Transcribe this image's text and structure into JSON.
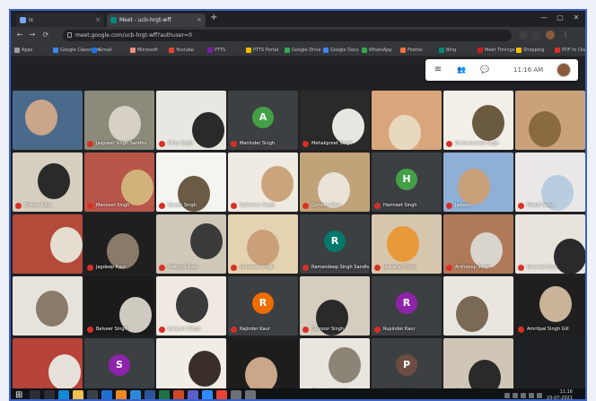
{
  "browser": {
    "tabs": [
      {
        "label": "Is",
        "active": false
      },
      {
        "label": "Meet - ucb-hrgt-wff",
        "active": true
      }
    ],
    "new_tab_symbol": "+",
    "address": "meet.google.com/ucb-hrgt-wff?authuser=0",
    "window_controls": [
      "—",
      "▢",
      "✕"
    ],
    "nav_icons": [
      "back-icon",
      "forward-icon",
      "reload-icon"
    ],
    "bookmarks": [
      "Apps",
      "Google Classroom",
      "Gmail",
      "Microsoft",
      "Youtube",
      "PTTS",
      "PTTS Portal",
      "Google Drive",
      "Google Docs",
      "WhatsApp",
      "Firefox",
      "Bing",
      "Meet Timings",
      "Shopping",
      "PDF to Doc"
    ]
  },
  "meet": {
    "toolbar_icons": [
      "menu-icon",
      "people-icon",
      "chat-icon"
    ],
    "time": "11:16 AM",
    "accent": "#1a73e8"
  },
  "participants": [
    {
      "name": "",
      "kind": "video",
      "colors": [
        "#4a6a8c",
        "#c9a58a"
      ]
    },
    {
      "name": "Jaspreet Singh Sandhu",
      "kind": "video",
      "colors": [
        "#8c8a7a",
        "#d6d1c4"
      ]
    },
    {
      "name": "Pintu Singh",
      "kind": "video",
      "colors": [
        "#e9e7e2",
        "#2a2a2a"
      ]
    },
    {
      "name": "Maninder Singh",
      "kind": "avatar",
      "initial": "A",
      "color": "#43a047"
    },
    {
      "name": "Mehakpreet Singh",
      "kind": "video",
      "colors": [
        "#2a2a2a",
        "#e8e6e1"
      ]
    },
    {
      "name": "",
      "kind": "video",
      "colors": [
        "#d9a57a",
        "#e8d8c0"
      ]
    },
    {
      "name": "Harmanpreet Singh",
      "kind": "video",
      "colors": [
        "#f2efe8",
        "#6a5a40"
      ]
    },
    {
      "name": "",
      "kind": "video",
      "colors": [
        "#c9a27a",
        "#8a6a40"
      ]
    },
    {
      "name": "Simran Kaur",
      "kind": "video",
      "colors": [
        "#d6cfc0",
        "#2a2a2a"
      ]
    },
    {
      "name": "Manveer Singh",
      "kind": "video",
      "colors": [
        "#b8564a",
        "#d1b27a"
      ]
    },
    {
      "name": "Navjot Singh",
      "kind": "video",
      "colors": [
        "#f4f4f1",
        "#6b5b45"
      ]
    },
    {
      "name": "Sukhman Singh",
      "kind": "video",
      "colors": [
        "#efeae2",
        "#caa47c"
      ]
    },
    {
      "name": "Gurleen Kaur",
      "kind": "video",
      "colors": [
        "#c1a37a",
        "#e9e3d8"
      ]
    },
    {
      "name": "Harmeet Singh",
      "kind": "avatar",
      "initial": "H",
      "color": "#43a047"
    },
    {
      "name": "Jasleen",
      "kind": "video",
      "colors": [
        "#8fb0d6",
        "#c8a07a"
      ]
    },
    {
      "name": "Manjit Singh",
      "kind": "video",
      "colors": [
        "#e9e8e6",
        "#b9cde0"
      ]
    },
    {
      "name": "",
      "kind": "video",
      "colors": [
        "#b34a3a",
        "#e4ddd0"
      ]
    },
    {
      "name": "Jagdeep Kaur",
      "kind": "video",
      "colors": [
        "#1f1f1f",
        "#8a7a68"
      ]
    },
    {
      "name": "Prabhjot Kaur",
      "kind": "video",
      "colors": [
        "#cfc7b8",
        "#3a3a3a"
      ]
    },
    {
      "name": "Gurpreet Singh",
      "kind": "video",
      "colors": [
        "#e4d2b0",
        "#caa07a"
      ]
    },
    {
      "name": "Ramandeep Singh Sandhu",
      "kind": "avatar",
      "initial": "R",
      "color": "#00796b"
    },
    {
      "name": "Jaskaran Singh",
      "kind": "video",
      "colors": [
        "#d7c6ae",
        "#e89a3a"
      ]
    },
    {
      "name": "Arshdeep Singh",
      "kind": "video",
      "colors": [
        "#b07a5a",
        "#d9d4cc"
      ]
    },
    {
      "name": "Navneet Kaur",
      "kind": "video",
      "colors": [
        "#e8e4dc",
        "#2a2a2a"
      ]
    },
    {
      "name": "",
      "kind": "video",
      "colors": [
        "#e6e3dd",
        "#8a7a6a"
      ]
    },
    {
      "name": "Balveer Singh",
      "kind": "video",
      "colors": [
        "#1b1b1b",
        "#cfcac0"
      ]
    },
    {
      "name": "Karanvir Singh",
      "kind": "video",
      "colors": [
        "#efe9e1",
        "#3a3a3a"
      ]
    },
    {
      "name": "Rajinder Kaur",
      "kind": "avatar",
      "initial": "R",
      "color": "#ef6c00"
    },
    {
      "name": "Gurnoor Singh",
      "kind": "video",
      "colors": [
        "#d5cdbf",
        "#2a2a2a"
      ]
    },
    {
      "name": "Rupinder Kaur",
      "kind": "avatar",
      "initial": "R",
      "color": "#8e24aa"
    },
    {
      "name": "",
      "kind": "video",
      "colors": [
        "#eae6df",
        "#7a6a55"
      ]
    },
    {
      "name": "Amritpal Singh Gill",
      "kind": "video",
      "colors": [
        "#1f1f1f",
        "#c9b49a"
      ]
    },
    {
      "name": "Tanveer Singh",
      "kind": "video",
      "colors": [
        "#b7433a",
        "#e6e1d9"
      ]
    },
    {
      "name": "Sukhpreet Kaur",
      "kind": "avatar",
      "initial": "S",
      "color": "#8e24aa"
    },
    {
      "name": "",
      "kind": "video",
      "colors": [
        "#f1ede6",
        "#3a2f28"
      ]
    },
    {
      "name": "Harjot Singh",
      "kind": "video",
      "colors": [
        "#1d1d1d",
        "#c9a788"
      ]
    },
    {
      "name": "Gurbaksh Singh",
      "kind": "video",
      "colors": [
        "#e9e6e0",
        "#8d8478"
      ]
    },
    {
      "name": "Paramjit Singh",
      "kind": "avatar",
      "initial": "P",
      "color": "#6d4c41"
    },
    {
      "name": "Preet Singh",
      "kind": "video",
      "colors": [
        "#cfc6b8",
        "#2a2a2a"
      ]
    }
  ],
  "taskbar": {
    "clock_time": "11:16",
    "clock_date": "23-07-2021",
    "apps": [
      "start-icon",
      "search-icon",
      "taskview-icon",
      "edge-icon",
      "explorer-icon",
      "store-icon",
      "mail-icon",
      "vlc-icon",
      "photos-icon",
      "word-icon",
      "excel-icon",
      "powerpoint-icon",
      "teams-icon",
      "zoom-icon",
      "chrome-icon",
      "settings-icon",
      "camera-icon"
    ]
  }
}
